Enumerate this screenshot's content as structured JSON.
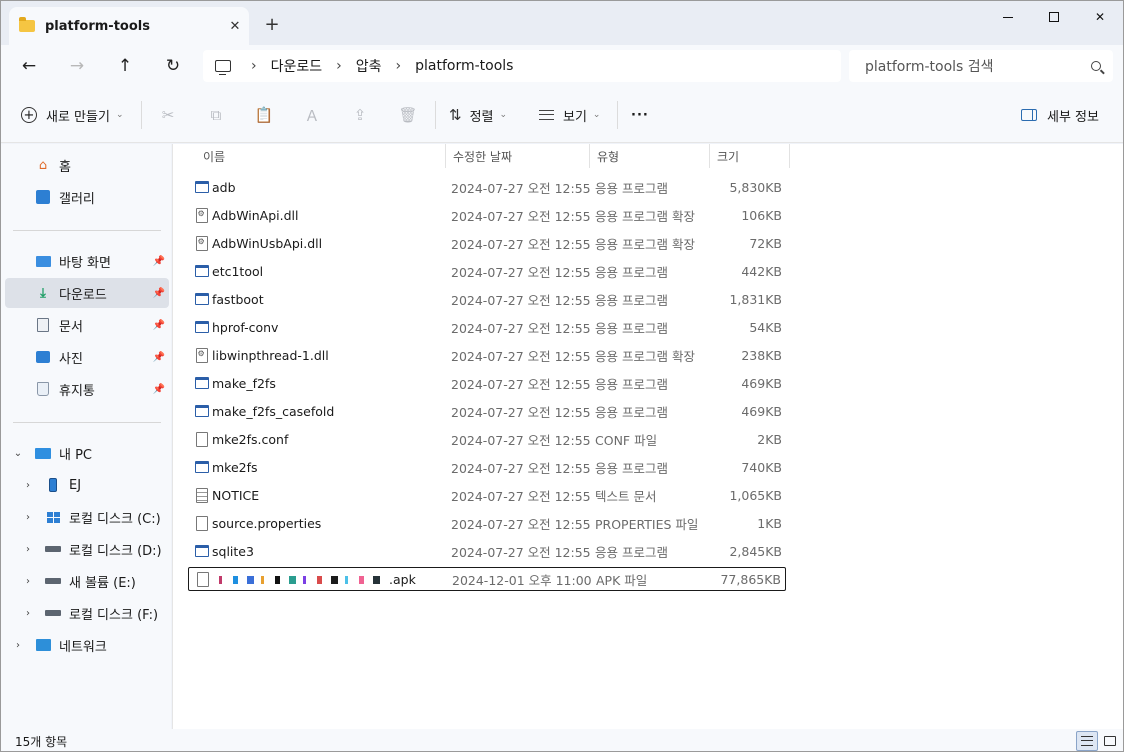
{
  "tab": {
    "title": "platform-tools",
    "close": "✕",
    "new_tab": "+"
  },
  "window_controls": {
    "minimize": "",
    "maximize": "",
    "close": "✕"
  },
  "nav": {
    "back": "←",
    "forward": "→",
    "up": "↑",
    "refresh": "↻"
  },
  "breadcrumb": [
    "다운로드",
    "압축",
    "platform-tools"
  ],
  "breadcrumb_sep": "›",
  "search": {
    "placeholder": "platform-tools 검색"
  },
  "toolbar": {
    "new_label": "새로 만들기",
    "sort_label": "정렬",
    "view_label": "보기",
    "more": "···",
    "details_label": "세부 정보",
    "icons": {
      "cut": "✂",
      "copy": "⧉",
      "paste": "📋",
      "rename": "Ａ",
      "share": "⇪",
      "delete": "🗑"
    }
  },
  "sidebar": {
    "quick": [
      {
        "label": "홈",
        "icon": "home-icon"
      },
      {
        "label": "갤러리",
        "icon": "gallery-icon"
      }
    ],
    "pinned": [
      {
        "label": "바탕 화면",
        "icon": "desktop-icon"
      },
      {
        "label": "다운로드",
        "icon": "download-icon",
        "selected": true
      },
      {
        "label": "문서",
        "icon": "document-icon"
      },
      {
        "label": "사진",
        "icon": "pictures-icon"
      },
      {
        "label": "휴지통",
        "icon": "recycle-bin-icon"
      }
    ],
    "this_pc": {
      "label": "내 PC"
    },
    "drives": [
      {
        "label": "EJ",
        "icon": "phone-icon"
      },
      {
        "label": "로컬 디스크 (C:)",
        "icon": "windows-drive-icon"
      },
      {
        "label": "로컬 디스크 (D:)",
        "icon": "drive-icon"
      },
      {
        "label": "새 볼륨 (E:)",
        "icon": "drive-icon"
      },
      {
        "label": "로컬 디스크 (F:)",
        "icon": "drive-icon"
      }
    ],
    "network": {
      "label": "네트워크"
    }
  },
  "columns": {
    "name": "이름",
    "modified": "수정한 날짜",
    "type": "유형",
    "size": "크기"
  },
  "files": [
    {
      "name": "adb",
      "modified": "2024-07-27 오전 12:55",
      "type": "응용 프로그램",
      "size": "5,830KB",
      "icon": "exe"
    },
    {
      "name": "AdbWinApi.dll",
      "modified": "2024-07-27 오전 12:55",
      "type": "응용 프로그램 확장",
      "size": "106KB",
      "icon": "dll"
    },
    {
      "name": "AdbWinUsbApi.dll",
      "modified": "2024-07-27 오전 12:55",
      "type": "응용 프로그램 확장",
      "size": "72KB",
      "icon": "dll"
    },
    {
      "name": "etc1tool",
      "modified": "2024-07-27 오전 12:55",
      "type": "응용 프로그램",
      "size": "442KB",
      "icon": "exe"
    },
    {
      "name": "fastboot",
      "modified": "2024-07-27 오전 12:55",
      "type": "응용 프로그램",
      "size": "1,831KB",
      "icon": "exe"
    },
    {
      "name": "hprof-conv",
      "modified": "2024-07-27 오전 12:55",
      "type": "응용 프로그램",
      "size": "54KB",
      "icon": "exe"
    },
    {
      "name": "libwinpthread-1.dll",
      "modified": "2024-07-27 오전 12:55",
      "type": "응용 프로그램 확장",
      "size": "238KB",
      "icon": "dll"
    },
    {
      "name": "make_f2fs",
      "modified": "2024-07-27 오전 12:55",
      "type": "응용 프로그램",
      "size": "469KB",
      "icon": "exe"
    },
    {
      "name": "make_f2fs_casefold",
      "modified": "2024-07-27 오전 12:55",
      "type": "응용 프로그램",
      "size": "469KB",
      "icon": "exe"
    },
    {
      "name": "mke2fs.conf",
      "modified": "2024-07-27 오전 12:55",
      "type": "CONF 파일",
      "size": "2KB",
      "icon": "doc"
    },
    {
      "name": "mke2fs",
      "modified": "2024-07-27 오전 12:55",
      "type": "응용 프로그램",
      "size": "740KB",
      "icon": "exe"
    },
    {
      "name": "NOTICE",
      "modified": "2024-07-27 오전 12:55",
      "type": "텍스트 문서",
      "size": "1,065KB",
      "icon": "txt"
    },
    {
      "name": "source.properties",
      "modified": "2024-07-27 오전 12:55",
      "type": "PROPERTIES 파일",
      "size": "1KB",
      "icon": "doc"
    },
    {
      "name": "sqlite3",
      "modified": "2024-07-27 오전 12:55",
      "type": "응용 프로그램",
      "size": "2,845KB",
      "icon": "exe"
    },
    {
      "name": ".apk",
      "modified": "2024-12-01 오후 11:00",
      "type": "APK 파일",
      "size": "77,865KB",
      "icon": "doc",
      "redacted": true,
      "focused": true
    }
  ],
  "status": {
    "item_count": "15개 항목"
  }
}
